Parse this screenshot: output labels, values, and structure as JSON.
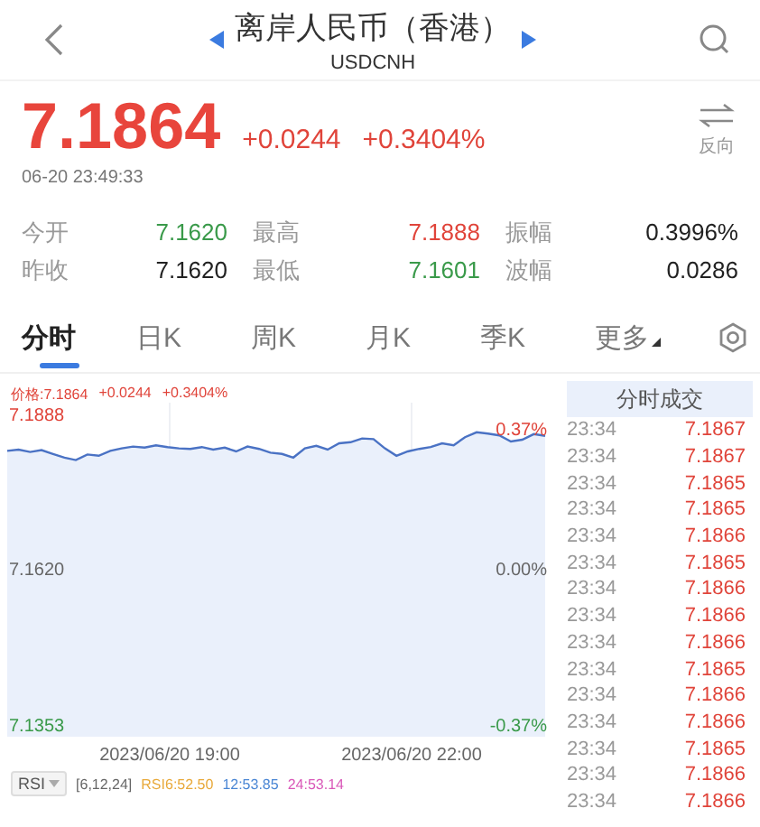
{
  "header": {
    "title": "离岸人民币（香港）",
    "subtitle": "USDCNH"
  },
  "quote": {
    "price": "7.1864",
    "change": "+0.0244",
    "change_pct": "+0.3404%",
    "time": "06-20 23:49:33",
    "reverse_label": "反向"
  },
  "stats": [
    [
      {
        "label": "今开",
        "value": "7.1620",
        "color": "#3a9a4a"
      },
      {
        "label": "最高",
        "value": "7.1888",
        "color": "#e0443a"
      },
      {
        "label": "振幅",
        "value": "0.3996%",
        "color": "#222222"
      }
    ],
    [
      {
        "label": "昨收",
        "value": "7.1620",
        "color": "#222222"
      },
      {
        "label": "最低",
        "value": "7.1601",
        "color": "#3a9a4a"
      },
      {
        "label": "波幅",
        "value": "0.0286",
        "color": "#222222"
      }
    ]
  ],
  "tabs": [
    {
      "label": "分时",
      "selected": true
    },
    {
      "label": "日K",
      "selected": false
    },
    {
      "label": "周K",
      "selected": false
    },
    {
      "label": "月K",
      "selected": false
    },
    {
      "label": "季K",
      "selected": false
    },
    {
      "label": "更多",
      "selected": false
    }
  ],
  "chart": {
    "legend": [
      "价格:7.1864",
      "+0.0244",
      "+0.3404%"
    ],
    "left_labels": [
      "7.1888",
      "7.1620",
      "7.1353"
    ],
    "right_labels": [
      "0.37%",
      "0.00%",
      "-0.37%"
    ],
    "time_labels": [
      "2023/06/20 19:00",
      "2023/06/20 22:00"
    ]
  },
  "indicator": {
    "name": "RSI",
    "params": "[6,12,24]",
    "values": [
      {
        "text": "RSI6:52.50",
        "color": "#e8a93a"
      },
      {
        "text": "12:53.85",
        "color": "#4a86d4"
      },
      {
        "text": "24:53.14",
        "color": "#d957b8"
      }
    ]
  },
  "trades": {
    "title": "分时成交",
    "rows": [
      {
        "time": "23:34",
        "price": "7.1867"
      },
      {
        "time": "23:34",
        "price": "7.1867"
      },
      {
        "time": "23:34",
        "price": "7.1865"
      },
      {
        "time": "23:34",
        "price": "7.1865"
      },
      {
        "time": "23:34",
        "price": "7.1866"
      },
      {
        "time": "23:34",
        "price": "7.1865"
      },
      {
        "time": "23:34",
        "price": "7.1866"
      },
      {
        "time": "23:34",
        "price": "7.1866"
      },
      {
        "time": "23:34",
        "price": "7.1866"
      },
      {
        "time": "23:34",
        "price": "7.1865"
      },
      {
        "time": "23:34",
        "price": "7.1866"
      },
      {
        "time": "23:34",
        "price": "7.1866"
      },
      {
        "time": "23:34",
        "price": "7.1865"
      },
      {
        "time": "23:34",
        "price": "7.1866"
      },
      {
        "time": "23:34",
        "price": "7.1866"
      }
    ]
  }
}
